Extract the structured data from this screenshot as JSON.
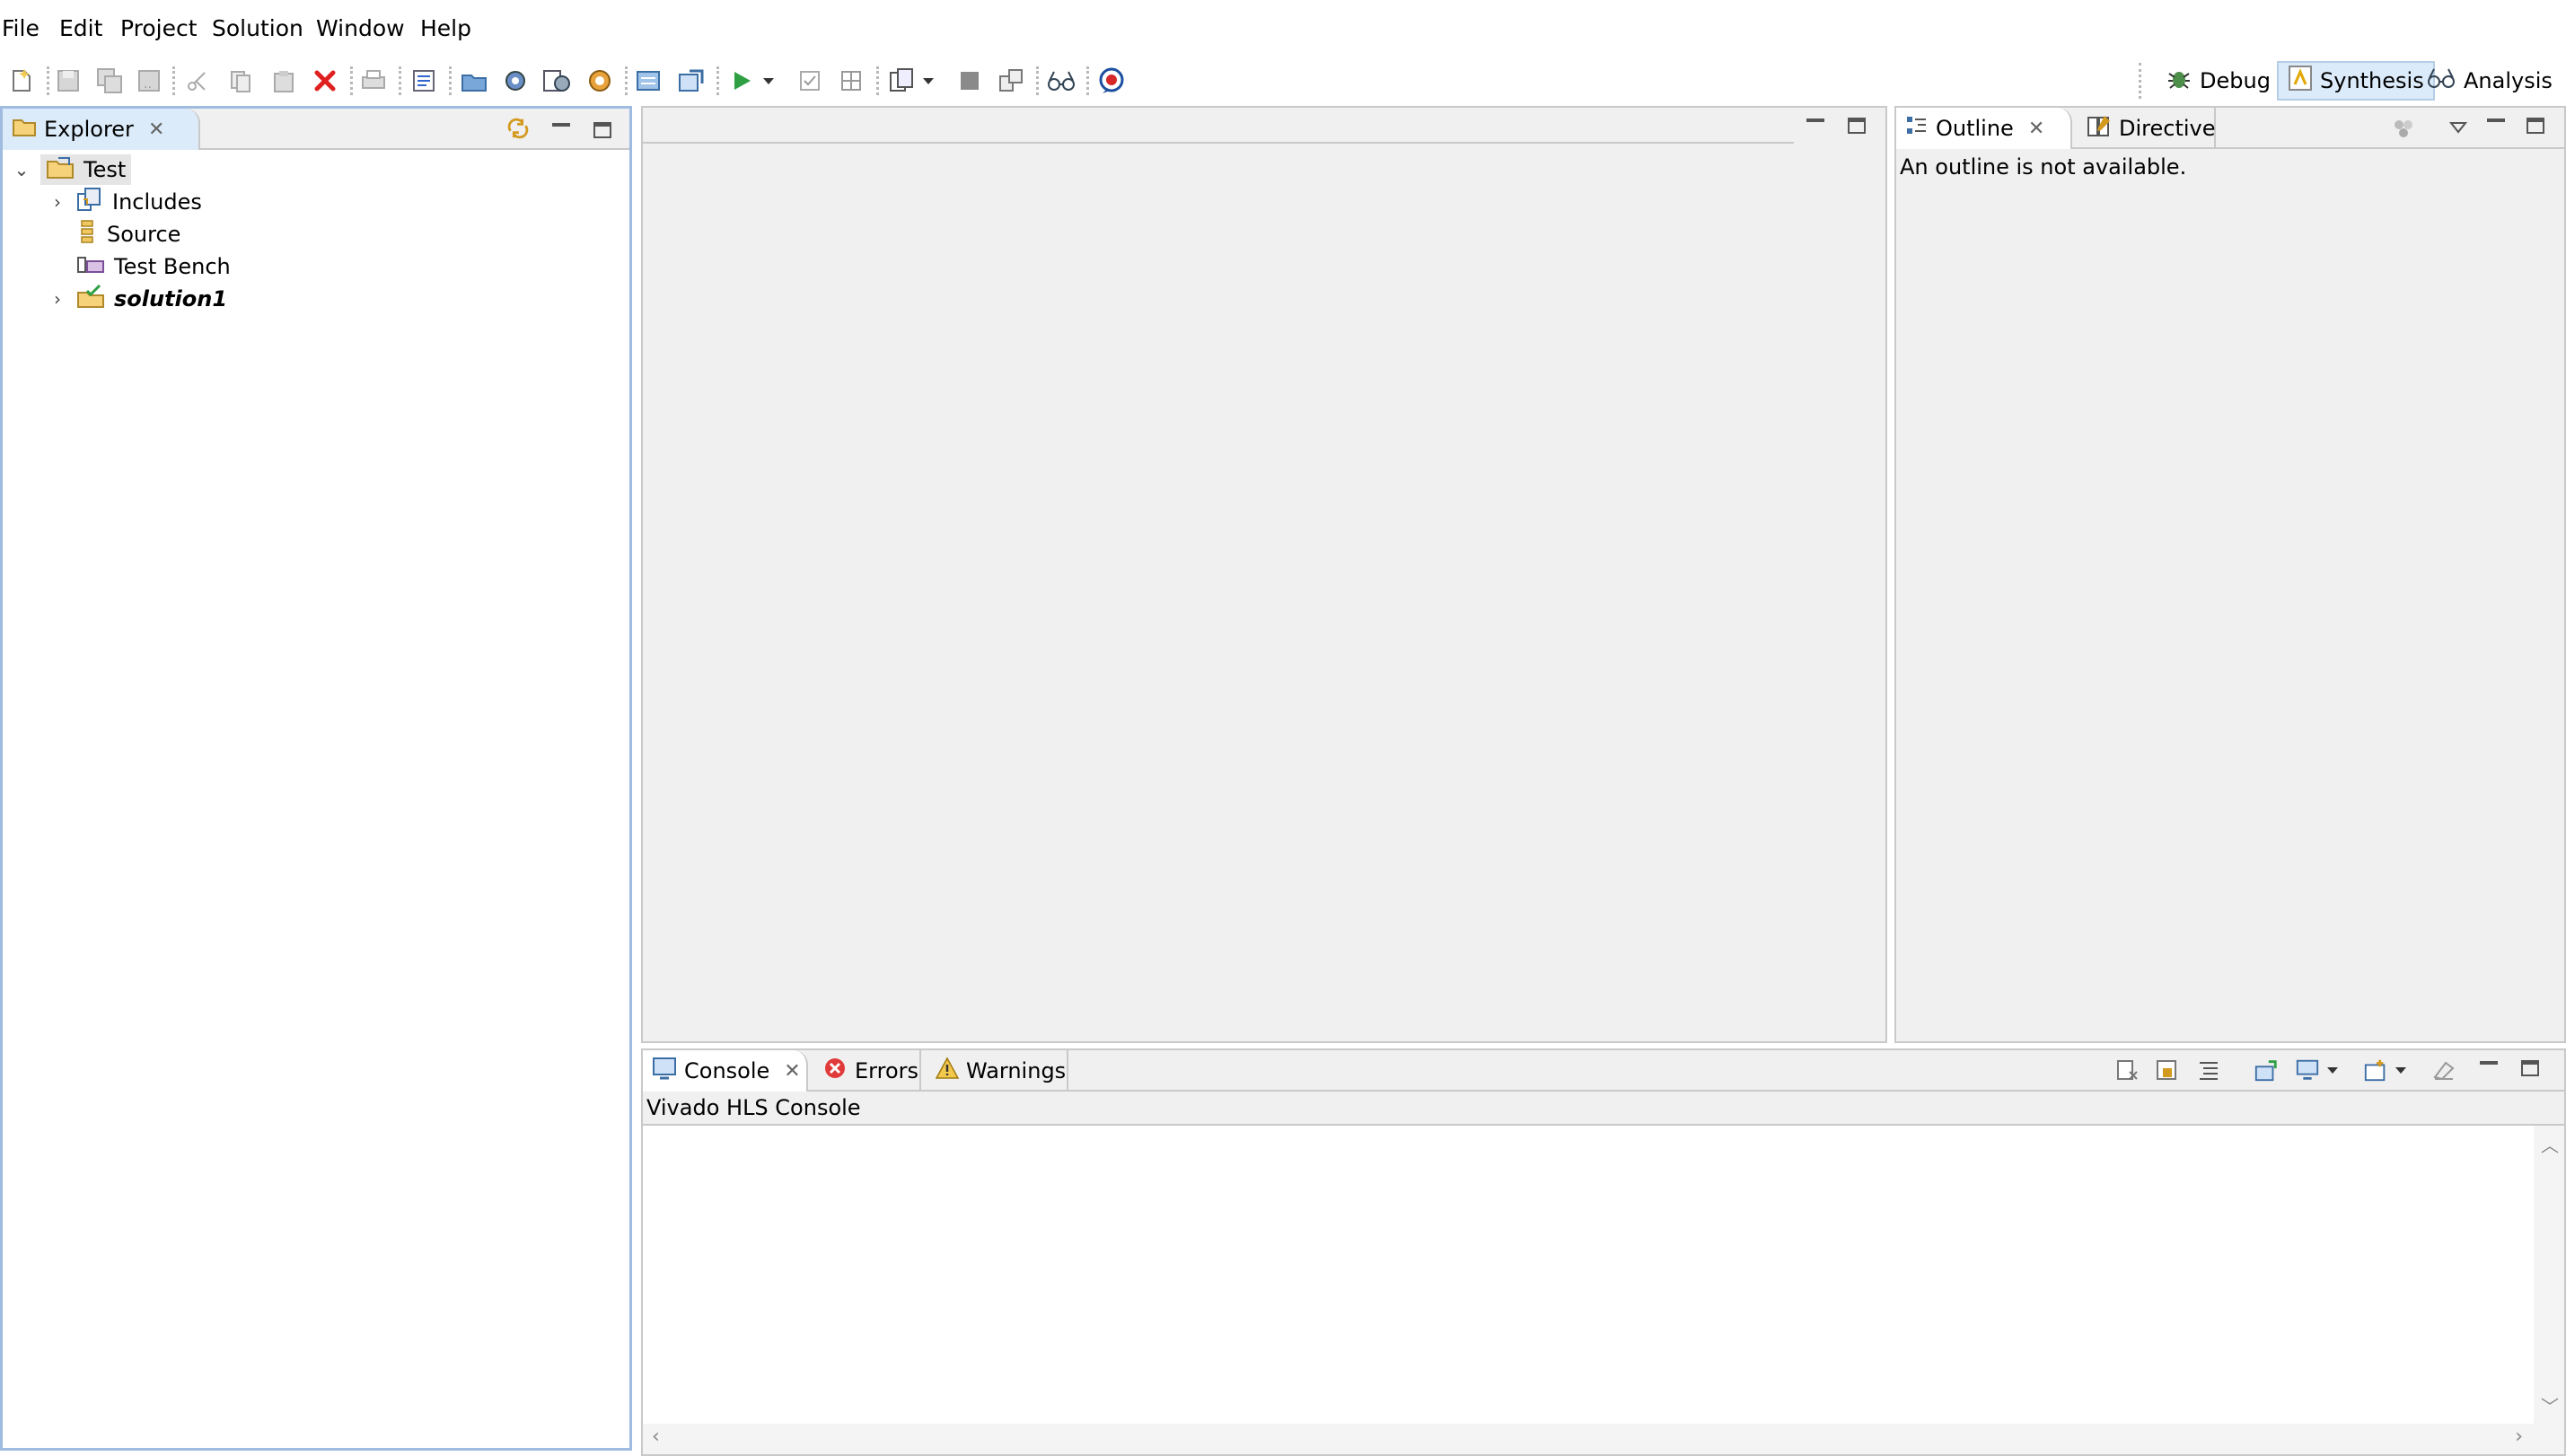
{
  "menubar": {
    "items": [
      "File",
      "Edit",
      "Project",
      "Solution",
      "Window",
      "Help"
    ]
  },
  "perspectives": [
    {
      "label": "Debug",
      "active": false,
      "icon": "bug-icon"
    },
    {
      "label": "Synthesis",
      "active": true,
      "icon": "synthesis-icon"
    },
    {
      "label": "Analysis",
      "active": false,
      "icon": "analysis-icon"
    }
  ],
  "explorer": {
    "tab_label": "Explorer",
    "tree": [
      {
        "label": "Test",
        "depth": 0,
        "expanded": true,
        "icon": "project-folder-icon"
      },
      {
        "label": "Includes",
        "depth": 1,
        "expandable": true,
        "icon": "includes-icon"
      },
      {
        "label": "Source",
        "depth": 1,
        "expandable": false,
        "icon": "source-icon"
      },
      {
        "label": "Test Bench",
        "depth": 1,
        "expandable": false,
        "icon": "test-bench-icon"
      },
      {
        "label": "solution1",
        "depth": 1,
        "expandable": true,
        "icon": "solution-folder-icon"
      }
    ]
  },
  "outline": {
    "tab_label": "Outline",
    "directive_tab_label": "Directive",
    "message": "An outline is not available."
  },
  "console": {
    "tabs": [
      {
        "label": "Console",
        "icon": "console-icon"
      },
      {
        "label": "Errors",
        "icon": "error-icon"
      },
      {
        "label": "Warnings",
        "icon": "warning-icon"
      }
    ],
    "title": "Vivado HLS Console"
  },
  "colors": {
    "panel_border": "#c9c9c9",
    "panel_bg": "#f0f0f0",
    "selection": "#dcebfa",
    "accent": "#2f6fb3"
  }
}
